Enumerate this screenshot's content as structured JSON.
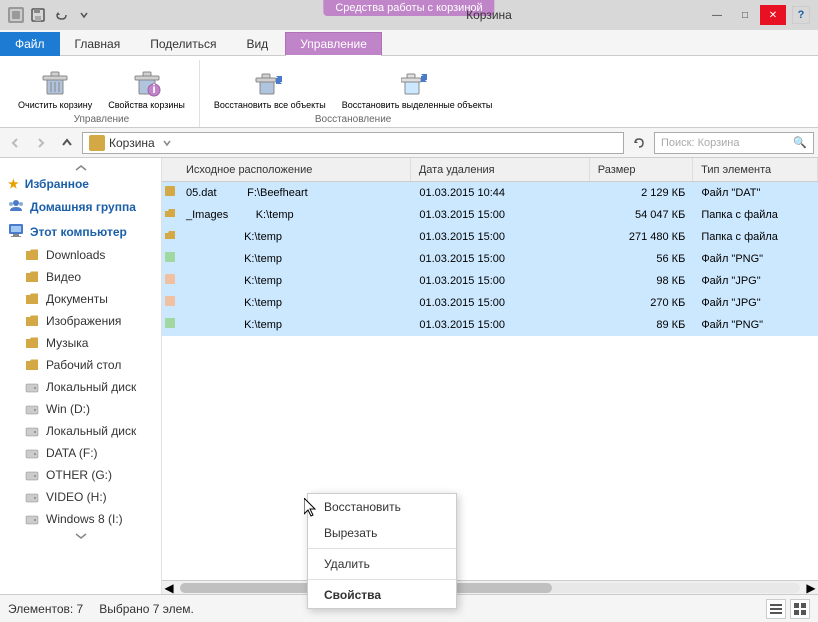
{
  "window": {
    "title": "Корзина",
    "ribbon_badge": "Средства работы с корзиной"
  },
  "titlebar": {
    "controls": {
      "minimize": "—",
      "maximize": "□",
      "close": "✕"
    }
  },
  "ribbon": {
    "tabs": [
      {
        "id": "file",
        "label": "Файл",
        "type": "file"
      },
      {
        "id": "home",
        "label": "Главная",
        "type": "normal"
      },
      {
        "id": "share",
        "label": "Поделиться",
        "type": "normal"
      },
      {
        "id": "view",
        "label": "Вид",
        "type": "normal"
      },
      {
        "id": "manage",
        "label": "Управление",
        "type": "upravlenie"
      }
    ],
    "groups": [
      {
        "id": "manage",
        "label": "Управление",
        "buttons": [
          {
            "id": "empty-trash",
            "label": "Очистить корзину"
          },
          {
            "id": "trash-props",
            "label": "Свойства корзины"
          }
        ]
      },
      {
        "id": "restore",
        "label": "Восстановление",
        "buttons": [
          {
            "id": "restore-all",
            "label": "Восстановить все объекты"
          },
          {
            "id": "restore-selected",
            "label": "Восстановить выделенные объекты"
          }
        ]
      }
    ]
  },
  "addressbar": {
    "path": "Корзина",
    "search_placeholder": "Поиск: Корзина"
  },
  "sidebar": {
    "sections": [
      {
        "id": "favorites",
        "label": "Избранное",
        "items": []
      },
      {
        "id": "homegroup",
        "label": "Домашняя группа",
        "items": []
      },
      {
        "id": "computer",
        "label": "Этот компьютер",
        "items": [
          {
            "id": "downloads",
            "label": "Downloads",
            "type": "folder"
          },
          {
            "id": "video",
            "label": "Видео",
            "type": "folder"
          },
          {
            "id": "documents",
            "label": "Документы",
            "type": "folder"
          },
          {
            "id": "images",
            "label": "Изображения",
            "type": "folder"
          },
          {
            "id": "music",
            "label": "Музыка",
            "type": "folder"
          },
          {
            "id": "desktop",
            "label": "Рабочий стол",
            "type": "folder"
          },
          {
            "id": "local-disk-c",
            "label": "Локальный диск",
            "type": "drive"
          },
          {
            "id": "win-d",
            "label": "Win (D:)",
            "type": "drive"
          },
          {
            "id": "local-disk-e",
            "label": "Локальный диск",
            "type": "drive"
          },
          {
            "id": "data-f",
            "label": "DATA (F:)",
            "type": "drive"
          },
          {
            "id": "other-g",
            "label": "OTHER (G:)",
            "type": "drive"
          },
          {
            "id": "video-h",
            "label": "VIDEO (H:)",
            "type": "drive"
          },
          {
            "id": "windows8-i",
            "label": "Windows 8 (I:)",
            "type": "drive"
          }
        ]
      }
    ]
  },
  "filelist": {
    "columns": [
      {
        "id": "name",
        "label": "Исходное расположение"
      },
      {
        "id": "date",
        "label": "Дата удаления"
      },
      {
        "id": "size",
        "label": "Размер"
      },
      {
        "id": "type",
        "label": "Тип элемента"
      }
    ],
    "rows": [
      {
        "id": "row1",
        "name": "05.dat",
        "location": "F:\\Beefheart",
        "date": "01.03.2015 10:44",
        "size": "2 129 КБ",
        "type": "Файл \"DAT\"",
        "selected": true
      },
      {
        "id": "row2",
        "name": "_Images",
        "location": "K:\\temp",
        "date": "01.03.2015 15:00",
        "size": "54 047 КБ",
        "type": "Папка с файла",
        "selected": true
      },
      {
        "id": "row3",
        "name": "",
        "location": "K:\\temp",
        "date": "01.03.2015 15:00",
        "size": "271 480 КБ",
        "type": "Папка с файла",
        "selected": true
      },
      {
        "id": "row4",
        "name": "",
        "location": "K:\\temp",
        "date": "01.03.2015 15:00",
        "size": "56 КБ",
        "type": "Файл \"PNG\"",
        "selected": true
      },
      {
        "id": "row5",
        "name": "",
        "location": "K:\\temp",
        "date": "01.03.2015 15:00",
        "size": "98 КБ",
        "type": "Файл \"JPG\"",
        "selected": true
      },
      {
        "id": "row6",
        "name": "",
        "location": "K:\\temp",
        "date": "01.03.2015 15:00",
        "size": "270 КБ",
        "type": "Файл \"JPG\"",
        "selected": true
      },
      {
        "id": "row7",
        "name": "",
        "location": "K:\\temp",
        "date": "01.03.2015 15:00",
        "size": "89 КБ",
        "type": "Файл \"PNG\"",
        "selected": true
      }
    ]
  },
  "context_menu": {
    "items": [
      {
        "id": "restore",
        "label": "Восстановить",
        "bold": false
      },
      {
        "id": "cut",
        "label": "Вырезать",
        "bold": false
      },
      {
        "id": "delete",
        "label": "Удалить",
        "bold": false
      },
      {
        "id": "properties",
        "label": "Свойства",
        "bold": true
      }
    ]
  },
  "statusbar": {
    "elements": "Элементов: 7",
    "selected": "Выбрано 7 элем."
  }
}
